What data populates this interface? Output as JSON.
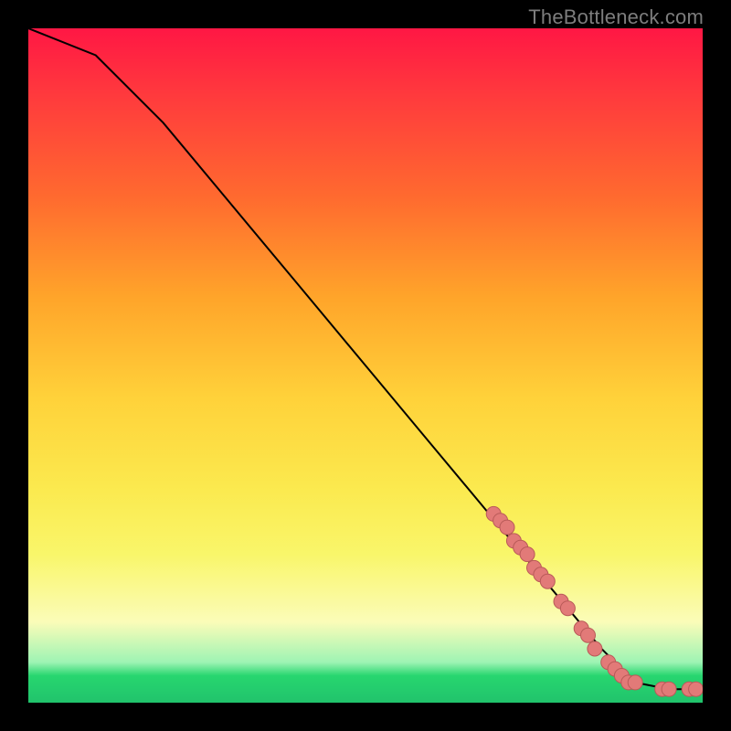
{
  "watermark": "TheBottleneck.com",
  "chart_data": {
    "type": "line",
    "title": "",
    "xlabel": "",
    "ylabel": "",
    "xlim": [
      0,
      100
    ],
    "ylim": [
      0,
      100
    ],
    "grid": false,
    "legend": false,
    "series": [
      {
        "name": "bottleneck-curve",
        "x": [
          0,
          10,
          20,
          30,
          40,
          50,
          60,
          70,
          75,
          80,
          85,
          90,
          95,
          100
        ],
        "y": [
          100,
          96,
          86,
          74,
          62,
          50,
          38,
          26,
          20,
          14,
          8,
          3,
          2,
          2
        ]
      }
    ],
    "points": {
      "name": "highlighted-segment",
      "x": [
        69,
        70,
        71,
        72,
        73,
        74,
        75,
        76,
        77,
        79,
        80,
        82,
        83,
        84,
        86,
        87,
        88,
        89,
        90,
        94,
        95,
        98,
        99
      ],
      "y": [
        28,
        27,
        26,
        24,
        23,
        22,
        20,
        19,
        18,
        15,
        14,
        11,
        10,
        8,
        6,
        5,
        4,
        3,
        3,
        2,
        2,
        2,
        2
      ]
    },
    "colors": {
      "curve": "#000000",
      "points_fill": "#e27a78",
      "points_stroke": "#b95a58"
    }
  }
}
